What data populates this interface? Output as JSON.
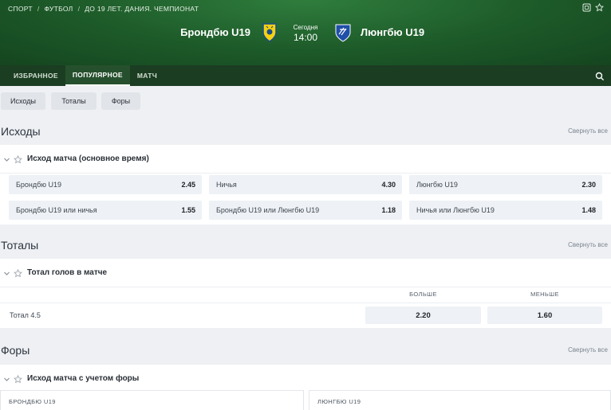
{
  "breadcrumb": [
    "СПОРТ",
    "ФУТБОЛ",
    "ДО 19 ЛЕТ. ДАНИЯ. ЧЕМПИОНАТ"
  ],
  "match": {
    "home": "Брондбю U19",
    "away": "Люнгбю U19",
    "day": "Сегодня",
    "time": "14:00"
  },
  "nav": {
    "tabs": [
      "ИЗБРАННОЕ",
      "ПОПУЛЯРНОЕ",
      "МАТЧ"
    ],
    "active": "ПОПУЛЯРНОЕ"
  },
  "filters": [
    "Исходы",
    "Тоталы",
    "Форы"
  ],
  "collapse_label": "Свернуть все",
  "outcomes": {
    "title": "Исходы",
    "market": "Исход матча (основное время)",
    "odds": [
      {
        "label": "Брондбю U19",
        "value": "2.45"
      },
      {
        "label": "Ничья",
        "value": "4.30"
      },
      {
        "label": "Люнгбю U19",
        "value": "2.30"
      },
      {
        "label": "Брондбю U19 или ничья",
        "value": "1.55"
      },
      {
        "label": "Брондбю U19 или Люнгбю U19",
        "value": "1.18"
      },
      {
        "label": "Ничья или Люнгбю U19",
        "value": "1.48"
      }
    ]
  },
  "totals": {
    "title": "Тоталы",
    "market": "Тотал голов в матче",
    "col_over": "БОЛЬШЕ",
    "col_under": "МЕНЬШЕ",
    "row_label": "Тотал 4.5",
    "over": "2.20",
    "under": "1.60"
  },
  "handicaps": {
    "title": "Форы",
    "market": "Исход матча с учетом форы",
    "col_home": "БРОНДБЮ U19",
    "col_away": "ЛЮНГБЮ U19"
  }
}
